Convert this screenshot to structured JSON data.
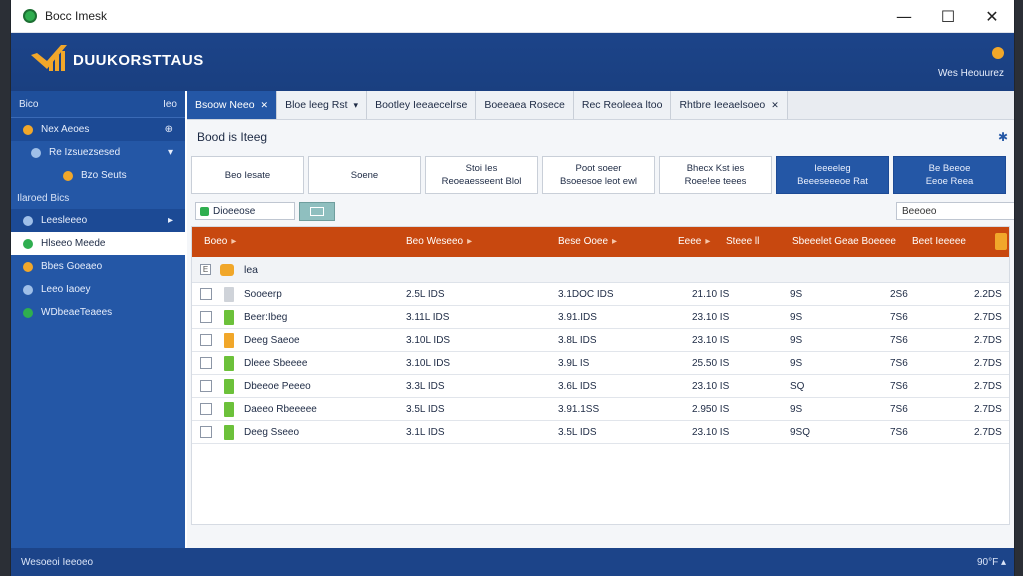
{
  "window": {
    "title": "Bocc Imesk",
    "minimize": "—",
    "maximize": "☐",
    "close": "✕"
  },
  "header": {
    "brand": "DUUKORSTTAUS",
    "user": "Wes Heouurez"
  },
  "sidebar": {
    "head_left": "Bico",
    "head_right": "Ieo",
    "items": [
      {
        "label": "Nex Aeoes",
        "icon_color": "#f1a72a",
        "trail": "⊕",
        "style": "sel"
      },
      {
        "label": "Re Izsuezsesed",
        "icon_color": "#9fbfe8",
        "trail": "▾",
        "style": ""
      },
      {
        "label": "Bzo Seuts",
        "icon_color": "#f1a72a",
        "trail": "",
        "style": "",
        "indent": 2
      }
    ],
    "section": "Ilaroed Bics",
    "items2": [
      {
        "label": "Leesleeeo",
        "icon_color": "#9fbfe8",
        "trail": "▸",
        "style": "sel"
      },
      {
        "label": "Hlseeo Meede",
        "icon_color": "#2fae4f",
        "trail": "",
        "style": "active"
      },
      {
        "label": "Bbes Goeaeo",
        "icon_color": "#f1a72a",
        "trail": "",
        "style": ""
      },
      {
        "label": "Leeo Iaoey",
        "icon_color": "#9fbfe8",
        "trail": "",
        "style": ""
      },
      {
        "label": "WDbeaeTeaees",
        "icon_color": "#2fae4f",
        "trail": "",
        "style": ""
      }
    ]
  },
  "tabs": [
    {
      "label": "Bsoow Neeo",
      "close": "✕",
      "active": true
    },
    {
      "label": "Bloe leeg Rst",
      "close": "▾",
      "active": false
    },
    {
      "label": "Bootley Ieeaecelrse",
      "close": "",
      "active": false
    },
    {
      "label": "Boeeaea Rosece",
      "close": "",
      "active": false
    },
    {
      "label": "Rec Reoleea ltoo",
      "close": "",
      "active": false
    },
    {
      "label": "Rhtbre Ieeaelsoeo",
      "close": "✕",
      "active": false
    }
  ],
  "main": {
    "title": "Bood is Iteeg",
    "title_icon": "✱",
    "cards": [
      {
        "line1": "Beo Iesate",
        "line2": "",
        "blue": false
      },
      {
        "line1": "Soene",
        "line2": "",
        "blue": false
      },
      {
        "line1": "Stoi Ies",
        "line2": "Reoeaesseent Blol",
        "blue": false
      },
      {
        "line1": "Poot soeer",
        "line2": "Bsoeesoe leot ewl",
        "blue": false
      },
      {
        "line1": "Bhecx Kst ies",
        "line2": "Roee!ee teees",
        "blue": false
      },
      {
        "line1": "Ieeeeleg",
        "line2": "Beeeseeeoe Rat",
        "blue": true
      },
      {
        "line1": "Be Beeoe",
        "line2": "Eeoe Reea",
        "blue": true
      }
    ],
    "filter_value": "Dioeeose",
    "search_value": "Beeoeo"
  },
  "grid": {
    "columns": [
      "Boeo",
      "Beo Weseeo",
      "Bese Ooee",
      "Eeee",
      "Steee ll",
      "Sbeeelet Geae Boeeee",
      "Beet Ieeeee"
    ],
    "group_label": "lea",
    "group_cb": "E",
    "rows": [
      {
        "name": "Sooeerp",
        "swatch": "#cfd3d9",
        "c1": "2.5L IDS",
        "c2": "3.1DOC IDS",
        "c3": "21.10 IS",
        "c4": "9S",
        "c5": "2S6",
        "c6": "2.2DS"
      },
      {
        "name": "Beer:Ibeg",
        "swatch": "#6cc13a",
        "c1": "3.11L IDS",
        "c2": "3.91.IDS",
        "c3": "23.10 IS",
        "c4": "9S",
        "c5": "7S6",
        "c6": "2.7DS"
      },
      {
        "name": "Deeg Saeoe",
        "swatch": "#f1a72a",
        "c1": "3.10L IDS",
        "c2": "3.8L IDS",
        "c3": "23.10 IS",
        "c4": "9S",
        "c5": "7S6",
        "c6": "2.7DS"
      },
      {
        "name": "Dleee Sbeeee",
        "swatch": "#6cc13a",
        "c1": "3.10L IDS",
        "c2": "3.9L IS",
        "c3": "25.50 IS",
        "c4": "9S",
        "c5": "7S6",
        "c6": "2.7DS"
      },
      {
        "name": "Dbeeoe Peeeo",
        "swatch": "#6cc13a",
        "c1": "3.3L IDS",
        "c2": "3.6L IDS",
        "c3": "23.10 IS",
        "c4": "SQ",
        "c5": "7S6",
        "c6": "2.7DS"
      },
      {
        "name": "Daeeo Rbeeeee",
        "swatch": "#6cc13a",
        "c1": "3.5L IDS",
        "c2": "3.91.1SS",
        "c3": "2.950 IS",
        "c4": "9S",
        "c5": "7S6",
        "c6": "2.7DS"
      },
      {
        "name": "Deeg Sseeo",
        "swatch": "#6cc13a",
        "c1": "3.1L IDS",
        "c2": "3.5L IDS",
        "c3": "23.10 IS",
        "c4": "9SQ",
        "c5": "7S6",
        "c6": "2.7DS"
      }
    ]
  },
  "statusbar": {
    "left": "Wesoeoi Ieeoeo",
    "right": "90°F  ▴"
  }
}
